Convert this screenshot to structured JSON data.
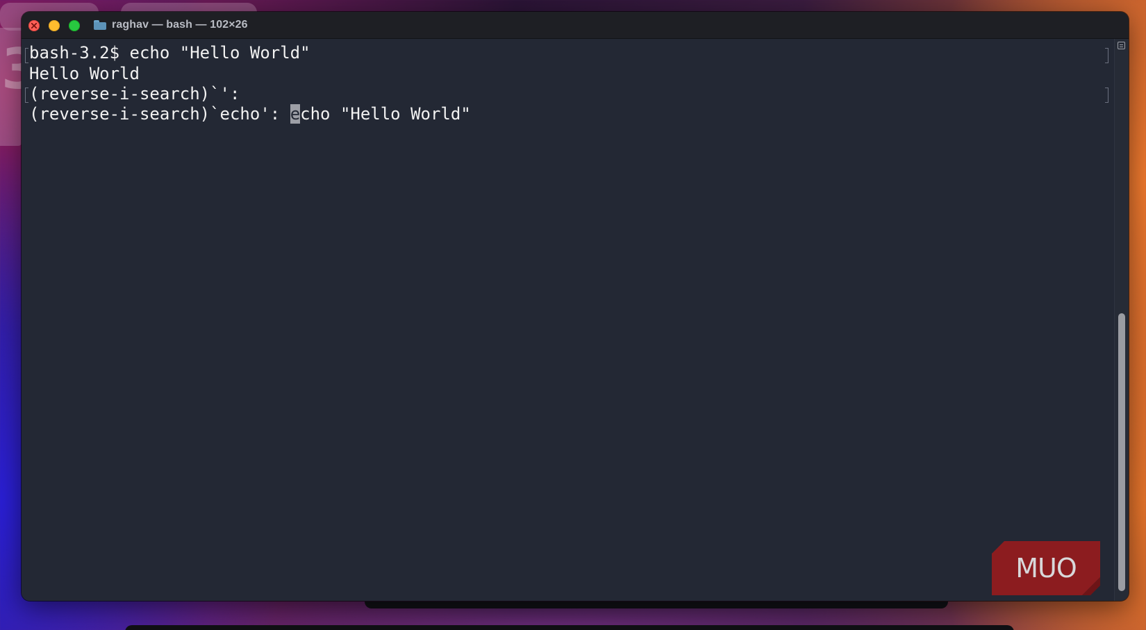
{
  "window": {
    "title": "raghav — bash — 102×26"
  },
  "terminal": {
    "lines": [
      {
        "text": "bash-3.2$ echo \"Hello World\""
      },
      {
        "text": "Hello World"
      },
      {
        "text": "(reverse-i-search)`':"
      },
      {
        "prefix": "(reverse-i-search)`echo': ",
        "cursor_char": "e",
        "suffix": "cho \"Hello World\""
      }
    ]
  },
  "watermark": {
    "text": "MUO"
  },
  "colors": {
    "background": "#232834",
    "text": "#f2f2f2",
    "close": "#fe5f57",
    "minimize": "#febc2e",
    "zoom": "#28c840",
    "logo_red": "#8c1c1f"
  },
  "icons": {
    "folder": "folder-icon",
    "scroll_widget": "list-icon"
  }
}
